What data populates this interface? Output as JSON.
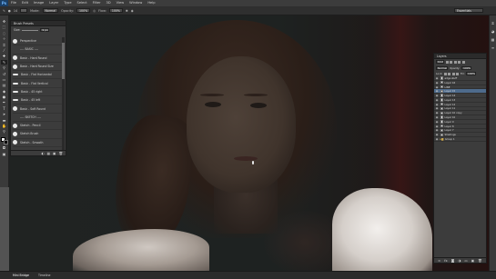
{
  "menubar": {
    "logo": "Ps",
    "items": [
      "File",
      "Edit",
      "Image",
      "Layer",
      "Type",
      "Select",
      "Filter",
      "3D",
      "View",
      "Window",
      "Help"
    ]
  },
  "options": {
    "brush_size": "14",
    "mode_label": "Mode:",
    "mode_value": "Normal",
    "opacity_label": "Opacity:",
    "opacity_value": "100%",
    "flow_label": "Flow:",
    "flow_value": "100%",
    "workspace": "Essentials"
  },
  "brush_panel": {
    "tab": "Brush Presets",
    "size_label": "Size:",
    "size_value": "9 px",
    "items": [
      {
        "label": "Perspective",
        "thumb": "round"
      },
      {
        "label": "---- BASIC ----",
        "thumb": "none"
      },
      {
        "label": "Basic - Hard Round",
        "thumb": "round"
      },
      {
        "label": "Basic - Hard Round Size",
        "thumb": "round"
      },
      {
        "label": "Basic - Flat Horizontal",
        "thumb": "flat"
      },
      {
        "label": "Basic - Flat Vertical",
        "thumb": "flat"
      },
      {
        "label": "Basic - 45 right",
        "thumb": "flat"
      },
      {
        "label": "Basic - 45 left",
        "thumb": "flat"
      },
      {
        "label": "Basic - Soft Round",
        "thumb": "round"
      },
      {
        "label": "---- SKETCH ----",
        "thumb": "none"
      },
      {
        "label": "Sketch - Pencil",
        "thumb": "round"
      },
      {
        "label": "Sketch Brush",
        "thumb": "round"
      },
      {
        "label": "Sketch - Smooth",
        "thumb": "round"
      }
    ]
  },
  "layers_panel": {
    "tab": "Layers",
    "kind_label": "Kind",
    "blend_mode": "Normal",
    "opacity_label": "Opacity:",
    "opacity_value": "100%",
    "lock_label": "Lock:",
    "fill_label": "Fill:",
    "fill_value": "100%",
    "layers": [
      {
        "name": "edge stuff",
        "type": "layer",
        "selected": false
      },
      {
        "name": "Layer 16",
        "type": "layer",
        "selected": false
      },
      {
        "name": "LINE",
        "type": "layer",
        "selected": false
      },
      {
        "name": "Layer 15",
        "type": "layer",
        "selected": true
      },
      {
        "name": "Layer 14",
        "type": "layer",
        "selected": false
      },
      {
        "name": "Layer 13",
        "type": "layer",
        "selected": false
      },
      {
        "name": "Layer 12",
        "type": "layer",
        "selected": false
      },
      {
        "name": "Layer 11",
        "type": "layer",
        "selected": false
      },
      {
        "name": "Layer 10 copy",
        "type": "layer",
        "selected": false
      },
      {
        "name": "Layer 10",
        "type": "layer",
        "selected": false
      },
      {
        "name": "Layer 9",
        "type": "layer",
        "selected": false
      },
      {
        "name": "Layer 8",
        "type": "layer",
        "selected": false
      },
      {
        "name": "Layer 7",
        "type": "layer",
        "selected": false
      },
      {
        "name": "Shadings",
        "type": "layer",
        "selected": false
      },
      {
        "name": "Group 1",
        "type": "group",
        "selected": false
      }
    ]
  },
  "bottombar": {
    "tabs": [
      "Mini Bridge",
      "Timeline"
    ]
  },
  "colors": {
    "foreground": "#ffffff",
    "background": "#000000",
    "selection": "#4e6b8c"
  }
}
